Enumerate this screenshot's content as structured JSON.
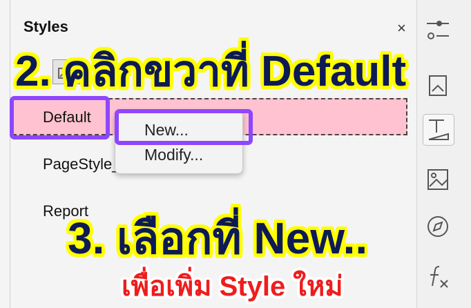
{
  "panel": {
    "title": "Styles",
    "close_icon": "×"
  },
  "styles_list": [
    {
      "label": "Default",
      "selected": true
    },
    {
      "label": "PageStyle_",
      "selected": false
    },
    {
      "label": "Report",
      "selected": false
    }
  ],
  "context_menu": {
    "items": [
      {
        "label": "New..."
      },
      {
        "label": "Modify..."
      }
    ]
  },
  "annotations": {
    "step2": "2. คลิกขวาที่  Default",
    "step3": "3. เลือกที่ New..",
    "step3_sub": "เพื่อเพิ่ม Style ใหม่"
  },
  "deck_icons": [
    "properties-icon",
    "page-icon",
    "styles-icon",
    "gallery-icon",
    "navigator-icon",
    "functions-icon"
  ],
  "colors": {
    "highlight": "#8f46ff",
    "selected_row": "#ffc2d0",
    "annotation_text": "#0d1a55",
    "annotation_outline": "#ffff00",
    "annotation_red": "#ee1d1d"
  }
}
